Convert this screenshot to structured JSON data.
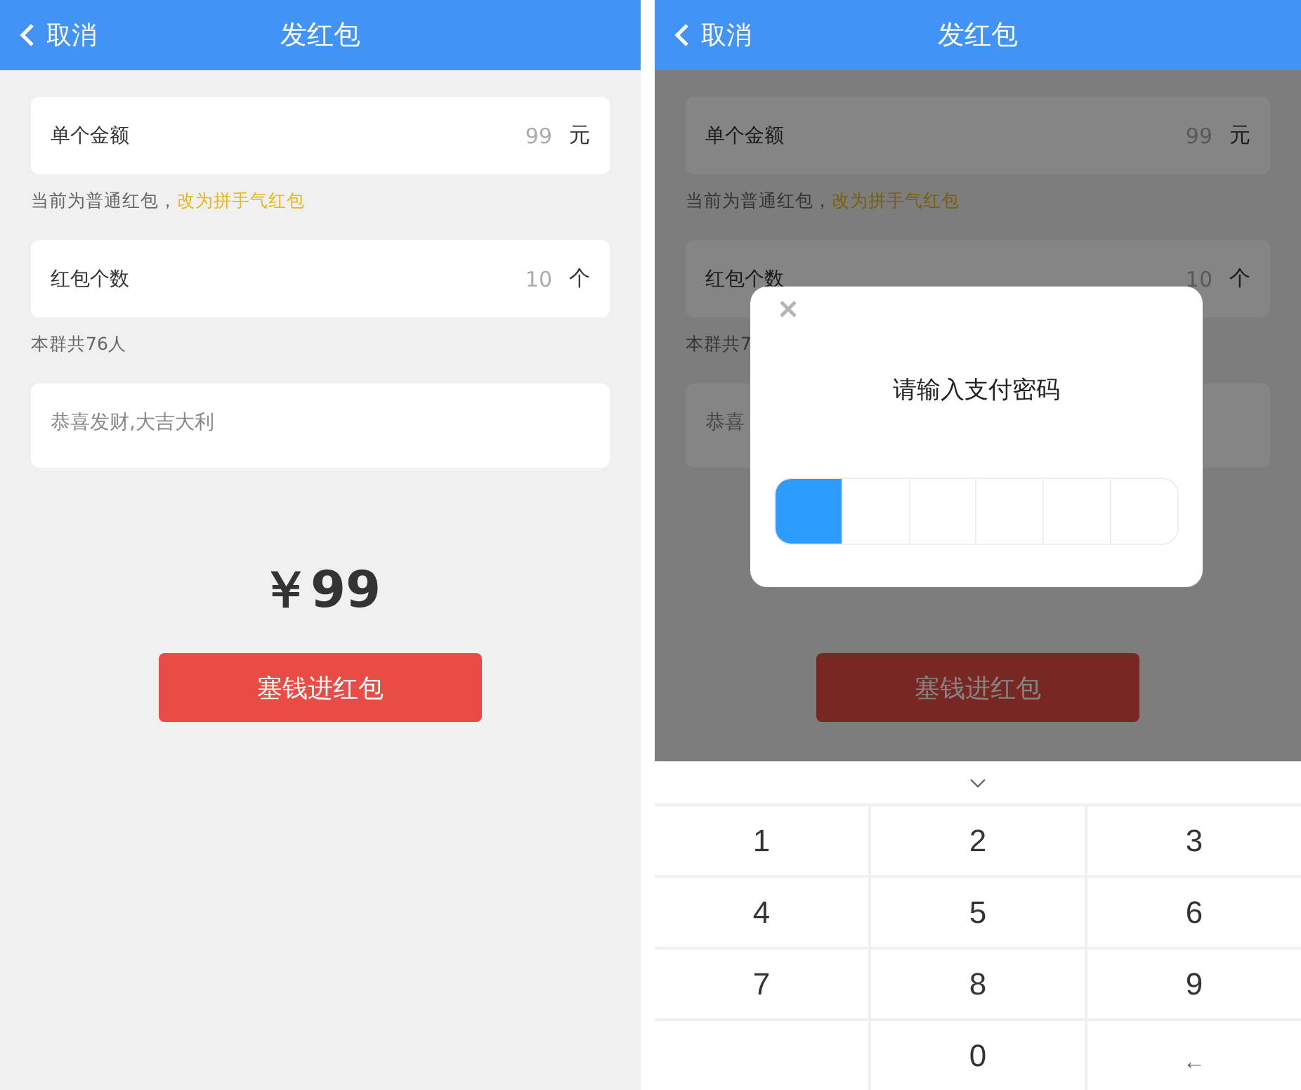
{
  "screens": [
    {
      "header": {
        "back_label": "取消",
        "title": "发红包"
      },
      "fields": [
        {
          "kind": "input",
          "label": "单个金额",
          "value": "99",
          "unit": "元"
        },
        {
          "kind": "note",
          "text": "当前为普通红包，",
          "link": "改为拼手气红包"
        },
        {
          "kind": "input",
          "label": "红包个数",
          "value": "10",
          "unit": "个"
        },
        {
          "kind": "note",
          "text": "本群共76人"
        },
        {
          "kind": "textarea",
          "placeholder": "恭喜发财,大吉大利"
        }
      ],
      "total": "￥99",
      "submit": "塞钱进红包",
      "dimmed": false
    },
    {
      "header": {
        "back_label": "取消",
        "title": "发红包"
      },
      "fields": [
        {
          "kind": "input",
          "label": "单个金额",
          "value": "99",
          "unit": "元"
        },
        {
          "kind": "note",
          "text": "当前为普通红包，",
          "link": "改为拼手气红包"
        },
        {
          "kind": "input",
          "label": "红包个数",
          "value": "10",
          "unit": "个"
        },
        {
          "kind": "note",
          "text": "本群共7"
        },
        {
          "kind": "textarea",
          "placeholder": "恭喜"
        }
      ],
      "submit": "塞钱进红包",
      "dimmed": true,
      "dialog": {
        "title": "请输入支付密码",
        "cells": [
          {
            "active": true
          },
          {
            "active": false
          },
          {
            "active": false
          },
          {
            "active": false
          },
          {
            "active": false
          },
          {
            "active": false
          }
        ]
      },
      "keypad": {
        "keys": [
          {
            "kind": "digit",
            "label": "1"
          },
          {
            "kind": "digit",
            "label": "2"
          },
          {
            "kind": "digit",
            "label": "3"
          },
          {
            "kind": "digit",
            "label": "4"
          },
          {
            "kind": "digit",
            "label": "5"
          },
          {
            "kind": "digit",
            "label": "6"
          },
          {
            "kind": "digit",
            "label": "7"
          },
          {
            "kind": "digit",
            "label": "8"
          },
          {
            "kind": "digit",
            "label": "9"
          },
          {
            "kind": "blank"
          },
          {
            "kind": "digit",
            "label": "0"
          },
          {
            "kind": "backspace",
            "label": "←"
          }
        ]
      }
    }
  ]
}
